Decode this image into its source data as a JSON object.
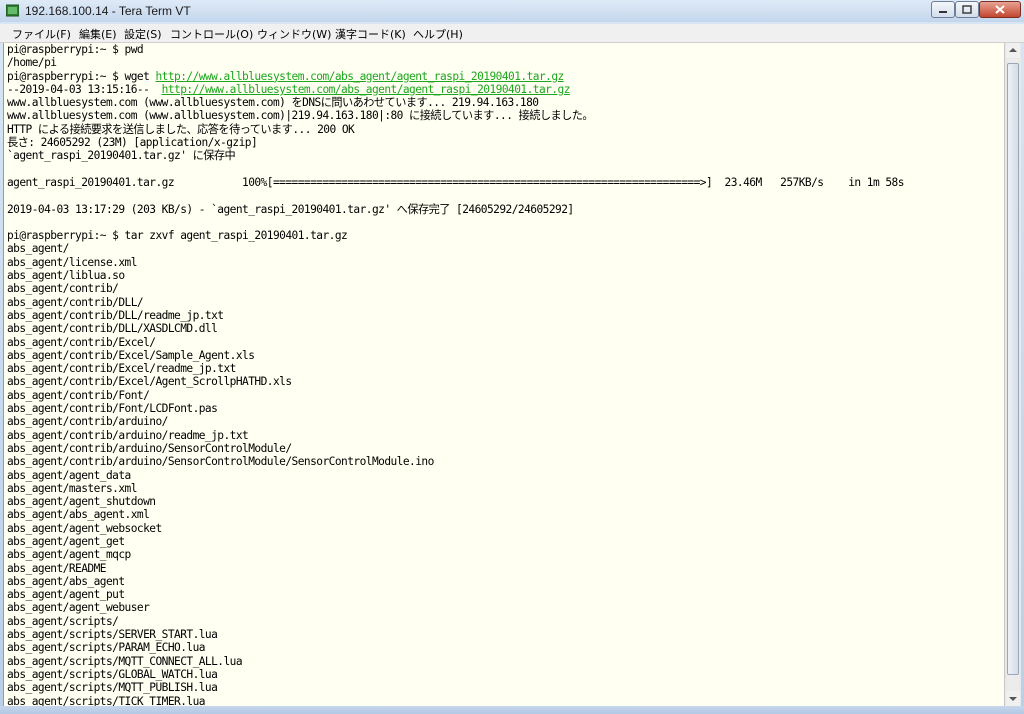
{
  "window": {
    "title": "192.168.100.14 - Tera Term VT"
  },
  "menu": [
    "ファイル(F)",
    "編集(E)",
    "設定(S)",
    "コントロール(O)",
    "ウィンドウ(W)",
    "漢字コード(K)",
    "ヘルプ(H)"
  ],
  "terminal": {
    "lines": [
      "pi@raspberrypi:~ $ pwd",
      "/home/pi",
      "pi@raspberrypi:~ $ wget http://www.allbluesystem.com/abs_agent/agent_raspi_20190401.tar.gz",
      "--2019-04-03 13:15:16--  http://www.allbluesystem.com/abs_agent/agent_raspi_20190401.tar.gz",
      "www.allbluesystem.com (www.allbluesystem.com) をDNSに問いあわせています... 219.94.163.180",
      "www.allbluesystem.com (www.allbluesystem.com)|219.94.163.180|:80 に接続しています... 接続しました。",
      "HTTP による接続要求を送信しました、応答を待っています... 200 OK",
      "長さ: 24605292 (23M) [application/x-gzip]",
      "`agent_raspi_20190401.tar.gz' に保存中",
      "",
      "agent_raspi_20190401.tar.gz           100%[=====================================================================>]  23.46M   257KB/s    in 1m 58s",
      "",
      "2019-04-03 13:17:29 (203 KB/s) - `agent_raspi_20190401.tar.gz' へ保存完了 [24605292/24605292]",
      "",
      "pi@raspberrypi:~ $ tar zxvf agent_raspi_20190401.tar.gz",
      "abs_agent/",
      "abs_agent/license.xml",
      "abs_agent/liblua.so",
      "abs_agent/contrib/",
      "abs_agent/contrib/DLL/",
      "abs_agent/contrib/DLL/readme_jp.txt",
      "abs_agent/contrib/DLL/XASDLCMD.dll",
      "abs_agent/contrib/Excel/",
      "abs_agent/contrib/Excel/Sample_Agent.xls",
      "abs_agent/contrib/Excel/readme_jp.txt",
      "abs_agent/contrib/Excel/Agent_ScrollpHATHD.xls",
      "abs_agent/contrib/Font/",
      "abs_agent/contrib/Font/LCDFont.pas",
      "abs_agent/contrib/arduino/",
      "abs_agent/contrib/arduino/readme_jp.txt",
      "abs_agent/contrib/arduino/SensorControlModule/",
      "abs_agent/contrib/arduino/SensorControlModule/SensorControlModule.ino",
      "abs_agent/agent_data",
      "abs_agent/masters.xml",
      "abs_agent/agent_shutdown",
      "abs_agent/abs_agent.xml",
      "abs_agent/agent_websocket",
      "abs_agent/agent_get",
      "abs_agent/agent_mqcp",
      "abs_agent/README",
      "abs_agent/abs_agent",
      "abs_agent/agent_put",
      "abs_agent/agent_webuser",
      "abs_agent/scripts/",
      "abs_agent/scripts/SERVER_START.lua",
      "abs_agent/scripts/PARAM_ECHO.lua",
      "abs_agent/scripts/MQTT_CONNECT_ALL.lua",
      "abs_agent/scripts/GLOBAL_WATCH.lua",
      "abs_agent/scripts/MQTT_PUBLISH.lua",
      "abs_agent/scripts/TICK_TIMER.lua"
    ],
    "link_url": "http://www.allbluesystem.com/abs_agent/agent_raspi_20190401.tar.gz"
  },
  "colors": {
    "terminal_bg": "#fffff2",
    "terminal_text": "#000000",
    "link": "#1ea61e"
  },
  "icons": {
    "app": "teraterm-icon",
    "minimize": "minimize-icon",
    "maximize": "maximize-icon",
    "close": "close-icon"
  }
}
